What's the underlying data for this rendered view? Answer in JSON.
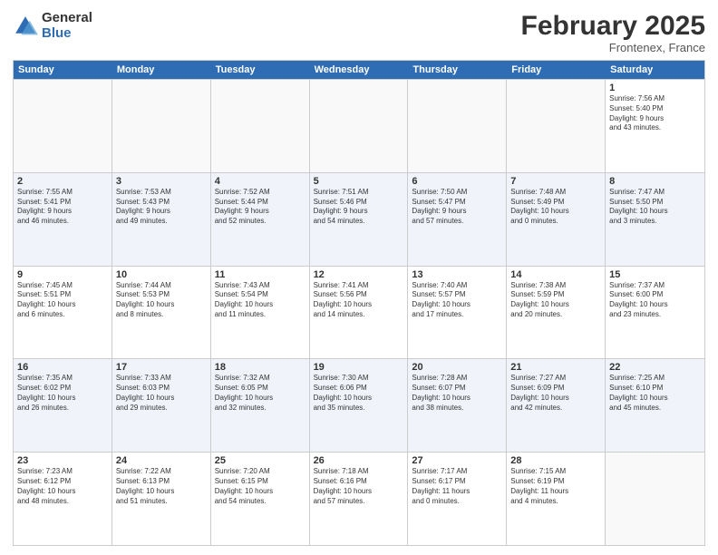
{
  "logo": {
    "general": "General",
    "blue": "Blue"
  },
  "title": "February 2025",
  "subtitle": "Frontenex, France",
  "days": [
    "Sunday",
    "Monday",
    "Tuesday",
    "Wednesday",
    "Thursday",
    "Friday",
    "Saturday"
  ],
  "weeks": [
    [
      {
        "day": "",
        "info": ""
      },
      {
        "day": "",
        "info": ""
      },
      {
        "day": "",
        "info": ""
      },
      {
        "day": "",
        "info": ""
      },
      {
        "day": "",
        "info": ""
      },
      {
        "day": "",
        "info": ""
      },
      {
        "day": "1",
        "info": "Sunrise: 7:56 AM\nSunset: 5:40 PM\nDaylight: 9 hours\nand 43 minutes."
      }
    ],
    [
      {
        "day": "2",
        "info": "Sunrise: 7:55 AM\nSunset: 5:41 PM\nDaylight: 9 hours\nand 46 minutes."
      },
      {
        "day": "3",
        "info": "Sunrise: 7:53 AM\nSunset: 5:43 PM\nDaylight: 9 hours\nand 49 minutes."
      },
      {
        "day": "4",
        "info": "Sunrise: 7:52 AM\nSunset: 5:44 PM\nDaylight: 9 hours\nand 52 minutes."
      },
      {
        "day": "5",
        "info": "Sunrise: 7:51 AM\nSunset: 5:46 PM\nDaylight: 9 hours\nand 54 minutes."
      },
      {
        "day": "6",
        "info": "Sunrise: 7:50 AM\nSunset: 5:47 PM\nDaylight: 9 hours\nand 57 minutes."
      },
      {
        "day": "7",
        "info": "Sunrise: 7:48 AM\nSunset: 5:49 PM\nDaylight: 10 hours\nand 0 minutes."
      },
      {
        "day": "8",
        "info": "Sunrise: 7:47 AM\nSunset: 5:50 PM\nDaylight: 10 hours\nand 3 minutes."
      }
    ],
    [
      {
        "day": "9",
        "info": "Sunrise: 7:45 AM\nSunset: 5:51 PM\nDaylight: 10 hours\nand 6 minutes."
      },
      {
        "day": "10",
        "info": "Sunrise: 7:44 AM\nSunset: 5:53 PM\nDaylight: 10 hours\nand 8 minutes."
      },
      {
        "day": "11",
        "info": "Sunrise: 7:43 AM\nSunset: 5:54 PM\nDaylight: 10 hours\nand 11 minutes."
      },
      {
        "day": "12",
        "info": "Sunrise: 7:41 AM\nSunset: 5:56 PM\nDaylight: 10 hours\nand 14 minutes."
      },
      {
        "day": "13",
        "info": "Sunrise: 7:40 AM\nSunset: 5:57 PM\nDaylight: 10 hours\nand 17 minutes."
      },
      {
        "day": "14",
        "info": "Sunrise: 7:38 AM\nSunset: 5:59 PM\nDaylight: 10 hours\nand 20 minutes."
      },
      {
        "day": "15",
        "info": "Sunrise: 7:37 AM\nSunset: 6:00 PM\nDaylight: 10 hours\nand 23 minutes."
      }
    ],
    [
      {
        "day": "16",
        "info": "Sunrise: 7:35 AM\nSunset: 6:02 PM\nDaylight: 10 hours\nand 26 minutes."
      },
      {
        "day": "17",
        "info": "Sunrise: 7:33 AM\nSunset: 6:03 PM\nDaylight: 10 hours\nand 29 minutes."
      },
      {
        "day": "18",
        "info": "Sunrise: 7:32 AM\nSunset: 6:05 PM\nDaylight: 10 hours\nand 32 minutes."
      },
      {
        "day": "19",
        "info": "Sunrise: 7:30 AM\nSunset: 6:06 PM\nDaylight: 10 hours\nand 35 minutes."
      },
      {
        "day": "20",
        "info": "Sunrise: 7:28 AM\nSunset: 6:07 PM\nDaylight: 10 hours\nand 38 minutes."
      },
      {
        "day": "21",
        "info": "Sunrise: 7:27 AM\nSunset: 6:09 PM\nDaylight: 10 hours\nand 42 minutes."
      },
      {
        "day": "22",
        "info": "Sunrise: 7:25 AM\nSunset: 6:10 PM\nDaylight: 10 hours\nand 45 minutes."
      }
    ],
    [
      {
        "day": "23",
        "info": "Sunrise: 7:23 AM\nSunset: 6:12 PM\nDaylight: 10 hours\nand 48 minutes."
      },
      {
        "day": "24",
        "info": "Sunrise: 7:22 AM\nSunset: 6:13 PM\nDaylight: 10 hours\nand 51 minutes."
      },
      {
        "day": "25",
        "info": "Sunrise: 7:20 AM\nSunset: 6:15 PM\nDaylight: 10 hours\nand 54 minutes."
      },
      {
        "day": "26",
        "info": "Sunrise: 7:18 AM\nSunset: 6:16 PM\nDaylight: 10 hours\nand 57 minutes."
      },
      {
        "day": "27",
        "info": "Sunrise: 7:17 AM\nSunset: 6:17 PM\nDaylight: 11 hours\nand 0 minutes."
      },
      {
        "day": "28",
        "info": "Sunrise: 7:15 AM\nSunset: 6:19 PM\nDaylight: 11 hours\nand 4 minutes."
      },
      {
        "day": "",
        "info": ""
      }
    ]
  ]
}
